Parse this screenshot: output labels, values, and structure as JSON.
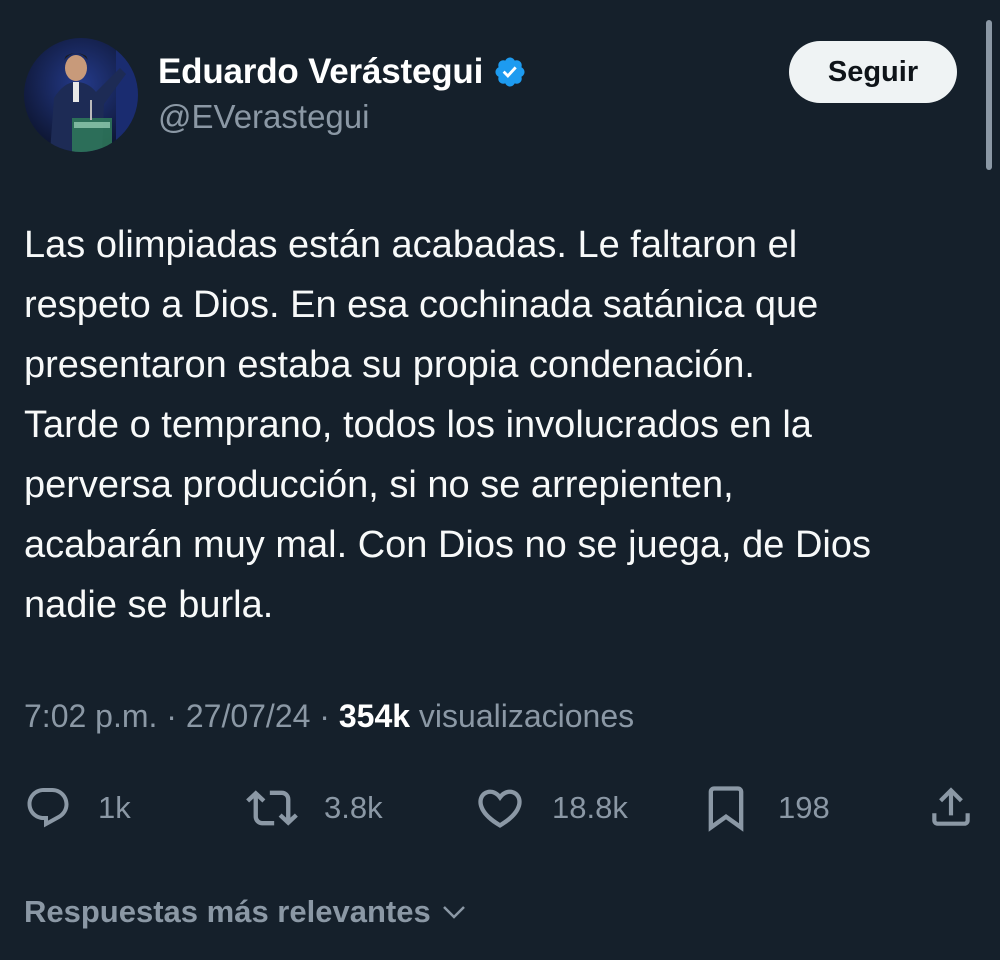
{
  "author": {
    "display_name": "Eduardo Verástegui",
    "handle": "@EVerastegui",
    "verified": true,
    "avatar": "profile-photo"
  },
  "follow_button": {
    "label": "Seguir"
  },
  "tweet": {
    "text": "Las olimpiadas están acabadas. Le faltaron el\nrespeto a Dios. En esa cochinada satánica que\npresentaron estaba su propia condenación.\nTarde o temprano, todos los involucrados en la\nperversa producción, si no se arrepienten,\nacabarán muy mal. Con Dios no se juega, de Dios\nnadie se burla."
  },
  "meta": {
    "time": "7:02 p.m.",
    "separator": "·",
    "date": "27/07/24",
    "views_count": "354k",
    "views_label": "visualizaciones"
  },
  "actions": {
    "replies": {
      "icon": "reply-icon",
      "count": "1k"
    },
    "reposts": {
      "icon": "repost-icon",
      "count": "3.8k"
    },
    "likes": {
      "icon": "like-icon",
      "count": "18.8k"
    },
    "bookmarks": {
      "icon": "bookmark-icon",
      "count": "198"
    },
    "share": {
      "icon": "share-icon"
    }
  },
  "replies_section": {
    "heading": "Respuestas más relevantes",
    "icon": "chevron-down-icon"
  },
  "colors": {
    "background": "#15202b",
    "text": "#f7f9f9",
    "secondary_text": "#8b98a5",
    "verified_blue": "#1d9bf0",
    "button_bg": "#eff3f4"
  }
}
